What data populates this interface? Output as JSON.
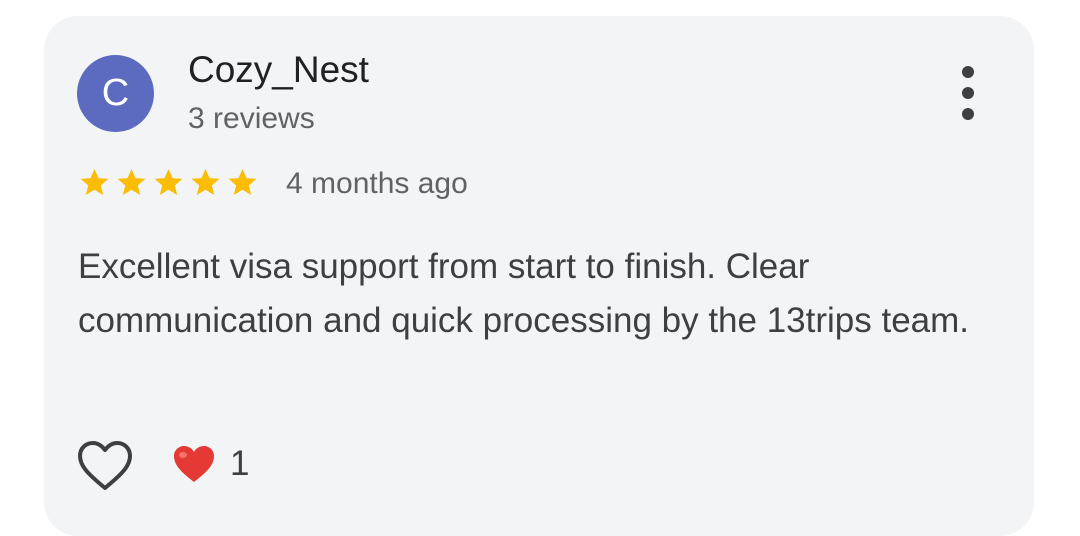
{
  "review": {
    "avatar_letter": "C",
    "avatar_color": "#5c6bc0",
    "reviewer_name": "Cozy_Nest",
    "review_count": "3 reviews",
    "rating": 5,
    "rating_max": 5,
    "star_color": "#fbbc04",
    "timestamp": "4 months ago",
    "text": "Excellent visa support from start to finish. Clear communication and quick processing by the 13trips team.",
    "reactions": {
      "heart_icon": "red-heart-icon",
      "count": "1"
    },
    "icons": {
      "more": "more-vert-icon",
      "like": "heart-outline-icon"
    }
  }
}
